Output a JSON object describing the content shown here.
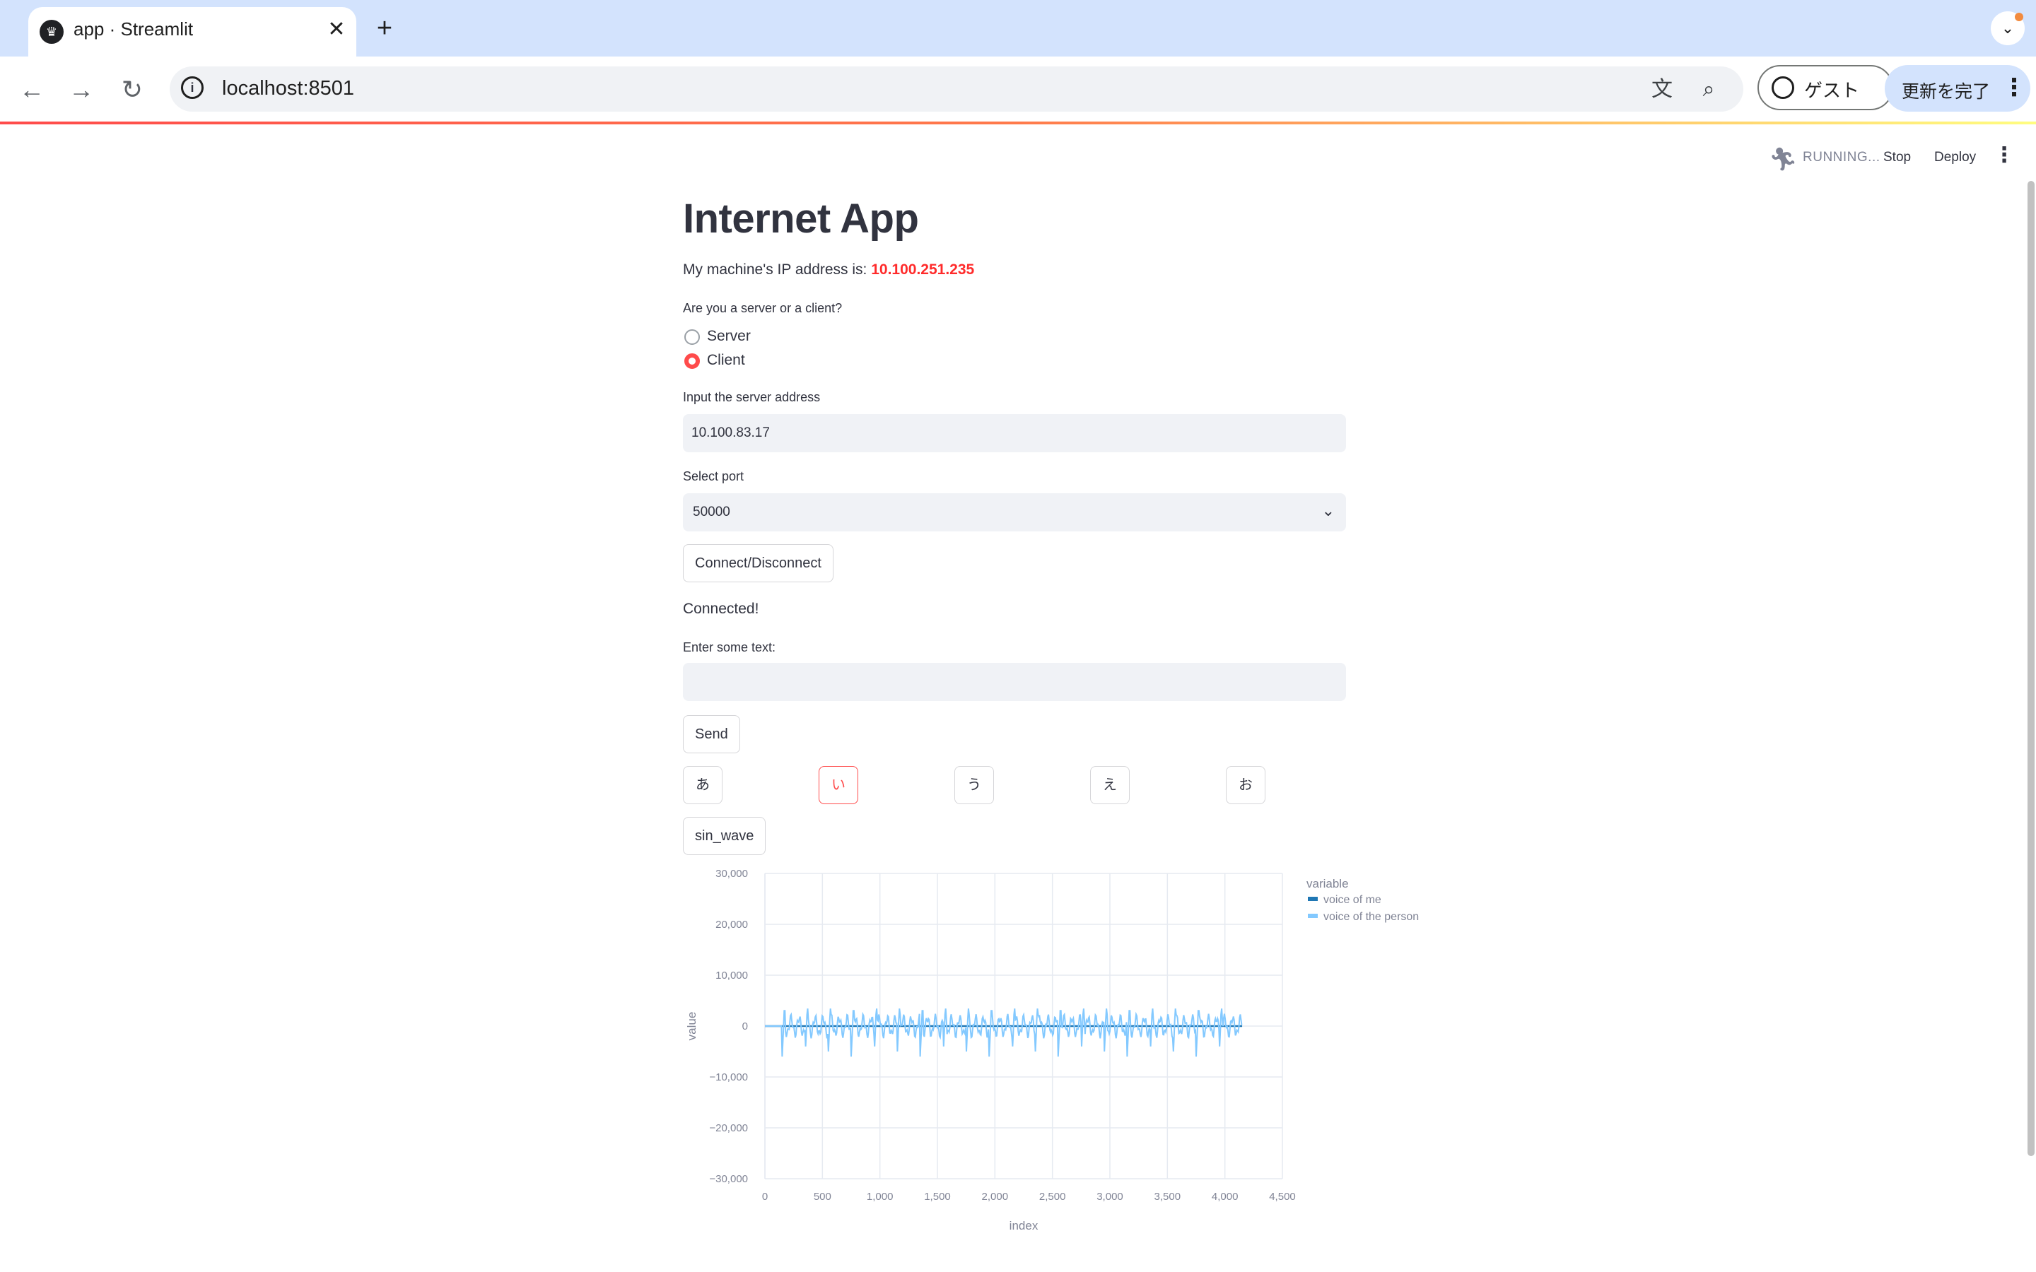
{
  "browser": {
    "tab_title": "app · Streamlit",
    "url": "localhost:8501",
    "guest_label": "ゲスト",
    "update_label": "更新を完了"
  },
  "streamlit_header": {
    "status": "RUNNING...",
    "stop_label": "Stop",
    "deploy_label": "Deploy"
  },
  "app": {
    "title": "Internet App",
    "ip_prefix": "My machine's IP address is: ",
    "ip_value": "10.100.251.235",
    "role_label": "Are you a server or a client?",
    "role_options": [
      "Server",
      "Client"
    ],
    "role_selected": "Client",
    "server_address_label": "Input the server address",
    "server_address_value": "10.100.83.17",
    "port_label": "Select port",
    "port_value": "50000",
    "connect_label": "Connect/Disconnect",
    "status_text": "Connected!",
    "text_label": "Enter some text:",
    "text_value": "",
    "send_label": "Send",
    "kana_buttons": [
      "あ",
      "い",
      "う",
      "え",
      "お"
    ],
    "kana_active": "い",
    "sin_wave_label": "sin_wave"
  },
  "colors": {
    "accent": "#ff4b4b",
    "ip_color": "#ff2b2b",
    "series_me": "#1f77b4",
    "series_person": "#83c9ff"
  },
  "chart_data": {
    "type": "line",
    "xlabel": "index",
    "ylabel": "value",
    "xlim": [
      0,
      4500
    ],
    "ylim": [
      -30000,
      30000
    ],
    "x_ticks": [
      0,
      500,
      1000,
      1500,
      2000,
      2500,
      3000,
      3500,
      4000,
      4500
    ],
    "x_tick_labels": [
      "0",
      "500",
      "1,000",
      "1,500",
      "2,000",
      "2,500",
      "3,000",
      "3,500",
      "4,000",
      "4,500"
    ],
    "y_ticks": [
      30000,
      20000,
      10000,
      0,
      -10000,
      -20000,
      -30000
    ],
    "y_tick_labels": [
      "30,000",
      "20,000",
      "10,000",
      "0",
      "−10,000",
      "−20,000",
      "−30,000"
    ],
    "grid": true,
    "legend_title": "variable",
    "legend_position": "right",
    "series": [
      {
        "name": "voice of me",
        "x_range": [
          0,
          4150
        ],
        "values_description_note": "",
        "amplitude": 0
      },
      {
        "name": "voice of the person",
        "x_range": [
          0,
          4150
        ],
        "onset": 150,
        "peak_high": 3500,
        "peak_low": -6000
      }
    ]
  }
}
